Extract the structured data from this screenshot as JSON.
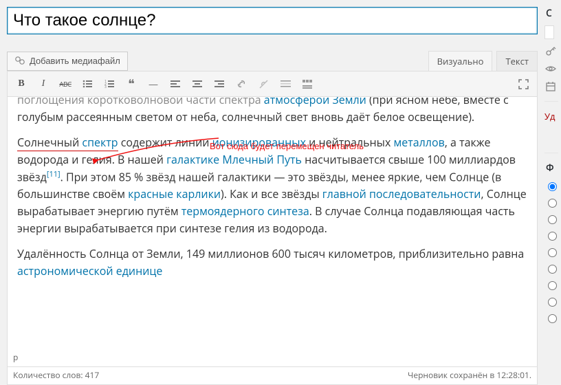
{
  "title": "Что такое солнце?",
  "media_button": "Добавить медиафайл",
  "tabs": {
    "visual": "Визуально",
    "text": "Текст"
  },
  "toolbar_icons": {
    "bold": "B",
    "italic": "I",
    "strike": "ABC",
    "ul": "≡",
    "ol": "≡",
    "quote": "❝",
    "hr": "—",
    "align_l": "≡",
    "align_c": "≡",
    "align_r": "≡",
    "link": "🔗",
    "unlink": "⊘",
    "more": "⋯",
    "fs": "⤢"
  },
  "body": {
    "frag_atm_link": "атмосферой Земли",
    "frag_atm_tail": " (при ясном небе, вместе с голубым рассеянным светом от неба, солнечный свет вновь даёт белое освещение).",
    "top_line_prefix": "поглощения коротковолновой части спектра ",
    "anchor_word1": "Солнечный ",
    "anchor_link": "спектр",
    "p2a": " содержит линии ",
    "p2_ion": "ионизированных",
    "p2b": " и нейтральных ",
    "p2_met": "металлов",
    "p2c": ", а также водорода и гелия. В нашей ",
    "p2_gal": "галактике",
    "p2_sp": " ",
    "p2_mw": "Млечный Путь",
    "p2d": " насчитывается свыше 100 миллиардов звёзд",
    "p2_ref": "[11]",
    "p2e": ". При этом 85 % звёзд нашей галактики — это звёзды, менее яркие, чем Солнце (в большинстве своём ",
    "p2_rd": "красные карлики",
    "p2f": "). Как и все звёзды ",
    "p2_ms": "главной последовательности",
    "p2g": ", Солнце вырабатывает энергию путём ",
    "p2_tf": "термоядерного синтеза",
    "p2h": ". В случае Солнца подавляющая часть энергии вырабатывается при синтезе гелия из водорода.",
    "p3a": "Удалённость Солнца от Земли, 149 миллионов 600 тысяч километров, приблизительно равна ",
    "p3_au": "астрономической единице"
  },
  "annotation_text": "Вот сюда будет перемещен читатель",
  "breadcrumb": "p",
  "word_count_label": "Количество слов: ",
  "word_count": "417",
  "draft_label": "Черновик сохранён в ",
  "draft_time": "12:28:01.",
  "side": {
    "initials": [
      "С",
      "Ф"
    ],
    "trash_label": "Уд"
  }
}
